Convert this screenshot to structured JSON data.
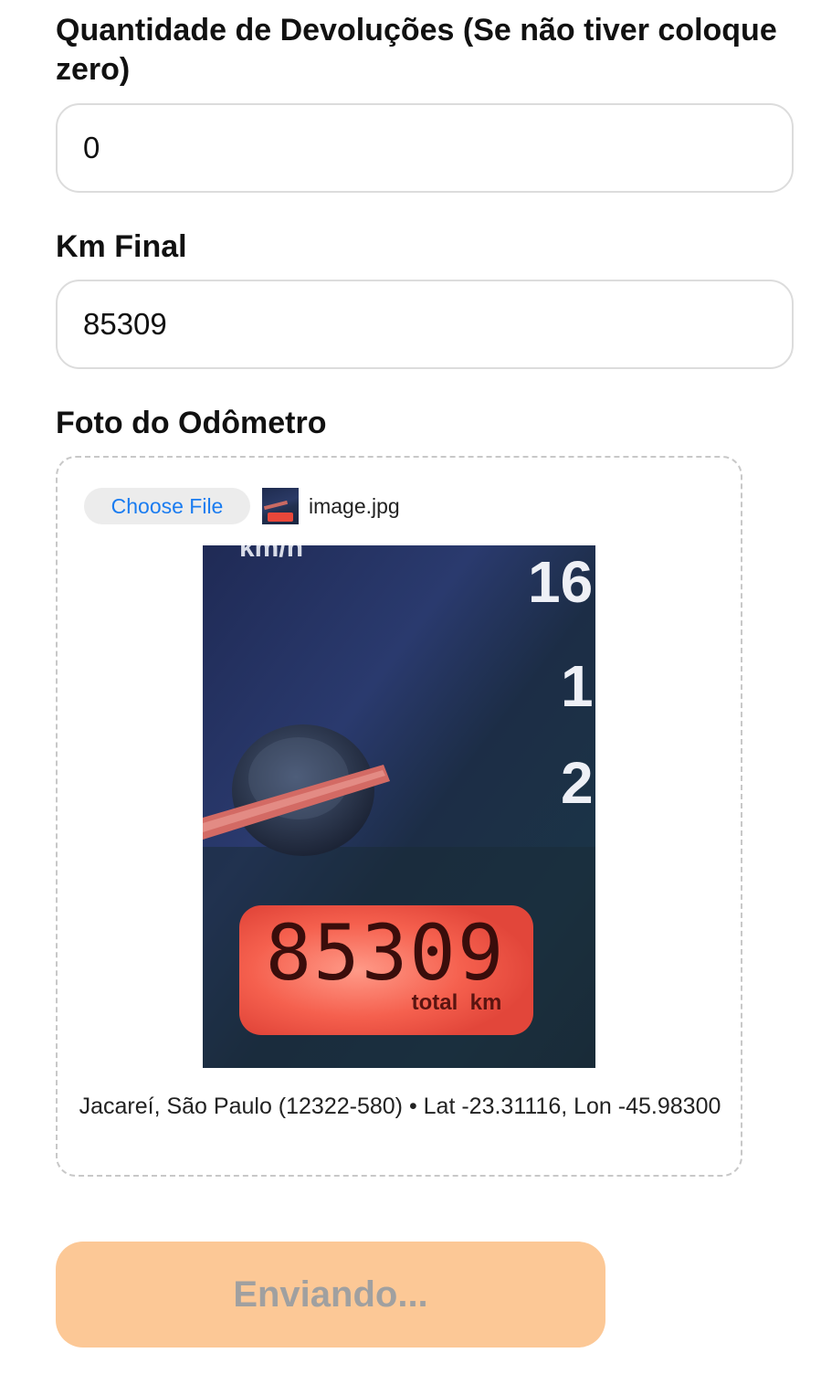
{
  "returns": {
    "label": "Quantidade de Devoluções (Se não tiver coloque zero)",
    "value": "0"
  },
  "km_final": {
    "label": "Km Final",
    "value": "85309"
  },
  "odometer_photo": {
    "label": "Foto do Odômetro",
    "choose_file_label": "Choose File",
    "file_name": "image.jpg",
    "thumbnail_icon": "odometer-thumbnail",
    "photo_text": {
      "unit_top": "km/h",
      "speed_marks": [
        "16",
        "1",
        "2"
      ],
      "reading": "85309",
      "reading_caption": "total  km"
    },
    "location": "Jacareí, São Paulo (12322-580) • Lat -23.31116, Lon -45.98300"
  },
  "submit": {
    "label": "Enviando..."
  },
  "colors": {
    "link_blue": "#1a7cf0",
    "button_disabled_bg": "#fcc896",
    "button_disabled_text": "#a0a0a0",
    "odometer_display": "#e8473a"
  }
}
